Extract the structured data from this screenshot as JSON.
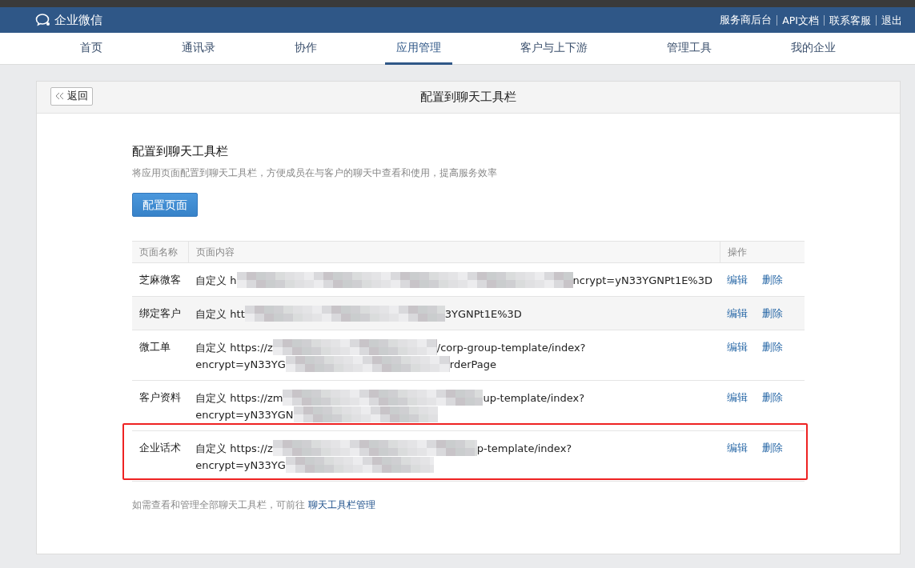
{
  "header": {
    "logo": "企业微信",
    "links": [
      "服务商后台",
      "API文档",
      "联系客服",
      "退出"
    ]
  },
  "tabs": [
    {
      "label": "首页",
      "selected": false
    },
    {
      "label": "通讯录",
      "selected": false
    },
    {
      "label": "协作",
      "selected": false
    },
    {
      "label": "应用管理",
      "selected": true
    },
    {
      "label": "客户与上下游",
      "selected": false
    },
    {
      "label": "管理工具",
      "selected": false
    },
    {
      "label": "我的企业",
      "selected": false
    }
  ],
  "panel": {
    "back_button": "返回",
    "title": "配置到聊天工具栏"
  },
  "section": {
    "title": "配置到聊天工具栏",
    "description": "将应用页面配置到聊天工具栏，方便成员在与客户的聊天中查看和使用，提高服务效率",
    "button": "配置页面"
  },
  "table": {
    "columns": [
      "页面名称",
      "页面内容",
      "操作"
    ],
    "rows": [
      {
        "name": "芝麻微客",
        "content_type": "自定义",
        "lines": [
          {
            "start": "h",
            "redacted": true,
            "end": "ncrypt=yN33YGNPt1E%3D"
          }
        ],
        "actions": [
          "编辑",
          "删除"
        ],
        "highlighted": false,
        "outlined": false
      },
      {
        "name": "绑定客户",
        "content_type": "自定义",
        "lines": [
          {
            "start": "htt",
            "redacted": true,
            "end": "3YGNPt1E%3D"
          }
        ],
        "actions": [
          "编辑",
          "删除"
        ],
        "highlighted": true,
        "outlined": false
      },
      {
        "name": "微工单",
        "content_type": "自定义",
        "lines": [
          {
            "start": "https://z",
            "redacted": true,
            "end": "/corp-group-template/index?"
          },
          {
            "start": "encrypt=yN33YG",
            "redacted": true,
            "end": "rderPage"
          }
        ],
        "actions": [
          "编辑",
          "删除"
        ],
        "highlighted": false,
        "outlined": false
      },
      {
        "name": "客户资料",
        "content_type": "自定义",
        "lines": [
          {
            "start": "https://zm",
            "redacted": true,
            "end": "up-template/index?"
          },
          {
            "start": "encrypt=yN33YGN",
            "redacted": true
          }
        ],
        "actions": [
          "编辑",
          "删除"
        ],
        "highlighted": false,
        "outlined": false
      },
      {
        "name": "企业话术",
        "content_type": "自定义",
        "lines": [
          {
            "start": "https://z",
            "redacted": true,
            "end": "p-template/index?"
          },
          {
            "start": "encrypt=yN33YG",
            "redacted": true
          }
        ],
        "actions": [
          "编辑",
          "删除"
        ],
        "highlighted": false,
        "outlined": true
      }
    ]
  },
  "footer": {
    "text": "如需查看和管理全部聊天工具栏，可前往",
    "link": "聊天工具栏管理"
  }
}
